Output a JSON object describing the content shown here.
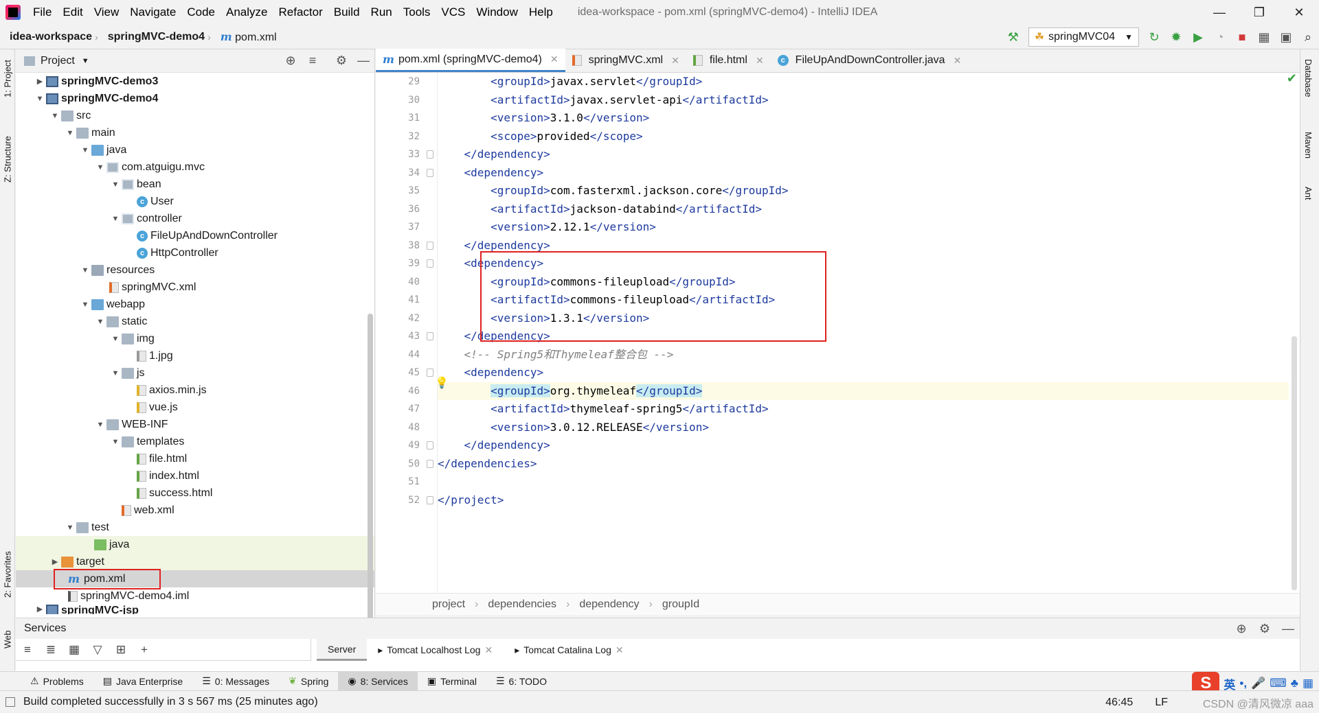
{
  "menubar": {
    "items": [
      "File",
      "Edit",
      "View",
      "Navigate",
      "Code",
      "Analyze",
      "Refactor",
      "Build",
      "Run",
      "Tools",
      "VCS",
      "Window",
      "Help"
    ],
    "title": "idea-workspace - pom.xml (springMVC-demo4) - IntelliJ IDEA"
  },
  "navbar": {
    "crumbs": [
      "idea-workspace",
      "springMVC-demo4",
      "pom.xml"
    ],
    "run_config": "springMVC04"
  },
  "project_panel": {
    "title": "Project",
    "tree": [
      {
        "label": "springMVC-demo3",
        "bold": true
      },
      {
        "label": "springMVC-demo4",
        "bold": true
      },
      {
        "label": "src"
      },
      {
        "label": "main"
      },
      {
        "label": "java"
      },
      {
        "label": "com.atguigu.mvc"
      },
      {
        "label": "bean"
      },
      {
        "label": "User"
      },
      {
        "label": "controller"
      },
      {
        "label": "FileUpAndDownController"
      },
      {
        "label": "HttpController"
      },
      {
        "label": "resources"
      },
      {
        "label": "springMVC.xml"
      },
      {
        "label": "webapp"
      },
      {
        "label": "static"
      },
      {
        "label": "img"
      },
      {
        "label": "1.jpg"
      },
      {
        "label": "js"
      },
      {
        "label": "axios.min.js"
      },
      {
        "label": "vue.js"
      },
      {
        "label": "WEB-INF"
      },
      {
        "label": "templates"
      },
      {
        "label": "file.html"
      },
      {
        "label": "index.html"
      },
      {
        "label": "success.html"
      },
      {
        "label": "web.xml"
      },
      {
        "label": "test"
      },
      {
        "label": "java"
      },
      {
        "label": "target"
      },
      {
        "label": "pom.xml"
      },
      {
        "label": "springMVC-demo4.iml"
      },
      {
        "label": "springMVC-jsp",
        "bold": true
      }
    ]
  },
  "editor": {
    "tabs": [
      {
        "label": "pom.xml (springMVC-demo4)"
      },
      {
        "label": "springMVC.xml"
      },
      {
        "label": "file.html"
      },
      {
        "label": "FileUpAndDownController.java"
      }
    ],
    "lines": [
      {
        "n": "29",
        "indent": "        ",
        "open": "<groupId>",
        "text": "javax.servlet",
        "close": "</groupId>"
      },
      {
        "n": "30",
        "indent": "        ",
        "open": "<artifactId>",
        "text": "javax.servlet-api",
        "close": "</artifactId>"
      },
      {
        "n": "31",
        "indent": "        ",
        "open": "<version>",
        "text": "3.1.0",
        "close": "</version>"
      },
      {
        "n": "32",
        "indent": "        ",
        "open": "<scope>",
        "text": "provided",
        "close": "</scope>"
      },
      {
        "n": "33",
        "indent": "    ",
        "open": "</dependency>",
        "text": "",
        "close": ""
      },
      {
        "n": "34",
        "indent": "    ",
        "open": "<dependency>",
        "text": "",
        "close": ""
      },
      {
        "n": "35",
        "indent": "        ",
        "open": "<groupId>",
        "text": "com.fasterxml.jackson.core",
        "close": "</groupId>"
      },
      {
        "n": "36",
        "indent": "        ",
        "open": "<artifactId>",
        "text": "jackson-databind",
        "close": "</artifactId>"
      },
      {
        "n": "37",
        "indent": "        ",
        "open": "<version>",
        "text": "2.12.1",
        "close": "</version>"
      },
      {
        "n": "38",
        "indent": "    ",
        "open": "</dependency>",
        "text": "",
        "close": ""
      },
      {
        "n": "39",
        "indent": "    ",
        "open": "<dependency>",
        "text": "",
        "close": ""
      },
      {
        "n": "40",
        "indent": "        ",
        "open": "<groupId>",
        "text": "commons-fileupload",
        "close": "</groupId>"
      },
      {
        "n": "41",
        "indent": "        ",
        "open": "<artifactId>",
        "text": "commons-fileupload",
        "close": "</artifactId>"
      },
      {
        "n": "42",
        "indent": "        ",
        "open": "<version>",
        "text": "1.3.1",
        "close": "</version>"
      },
      {
        "n": "43",
        "indent": "    ",
        "open": "</dependency>",
        "text": "",
        "close": ""
      },
      {
        "n": "44",
        "indent": "    ",
        "comment": "<!-- Spring5和Thymeleaf整合包 -->"
      },
      {
        "n": "45",
        "indent": "    ",
        "open": "<dependency>",
        "text": "",
        "close": ""
      },
      {
        "n": "46",
        "indent": "        ",
        "open": "<groupId>",
        "text": "org.thymeleaf",
        "close": "</groupId>"
      },
      {
        "n": "47",
        "indent": "        ",
        "open": "<artifactId>",
        "text": "thymeleaf-spring5",
        "close": "</artifactId>"
      },
      {
        "n": "48",
        "indent": "        ",
        "open": "<version>",
        "text": "3.0.12.RELEASE",
        "close": "</version>"
      },
      {
        "n": "49",
        "indent": "    ",
        "open": "</dependency>",
        "text": "",
        "close": ""
      },
      {
        "n": "50",
        "indent": "",
        "open": "</dependencies>",
        "text": "",
        "close": ""
      },
      {
        "n": "51",
        "indent": "",
        "open": "",
        "text": "",
        "close": ""
      },
      {
        "n": "52",
        "indent": "",
        "open": "</project>",
        "text": "",
        "close": ""
      }
    ],
    "breadcrumb": [
      "project",
      "dependencies",
      "dependency",
      "groupId"
    ]
  },
  "right_strip": {
    "items": [
      "Database",
      "Maven",
      "Ant"
    ]
  },
  "left_strip": {
    "items": [
      "1: Project",
      "Z: Structure",
      "2: Favorites",
      "Web"
    ]
  },
  "services": {
    "title": "Services",
    "tabs": [
      "Server",
      "Tomcat Localhost Log",
      "Tomcat Catalina Log"
    ]
  },
  "tool_bar": {
    "items": [
      "Problems",
      "Java Enterprise",
      "0: Messages",
      "Spring",
      "8: Services",
      "Terminal",
      "6: TODO"
    ]
  },
  "status": {
    "message": "Build completed successfully in 3 s 567 ms (25 minutes ago)",
    "position": "46:45",
    "line_sep": "LF",
    "watermark": "CSDN @清风微凉 aaa"
  },
  "ime": {
    "mode": "英"
  }
}
